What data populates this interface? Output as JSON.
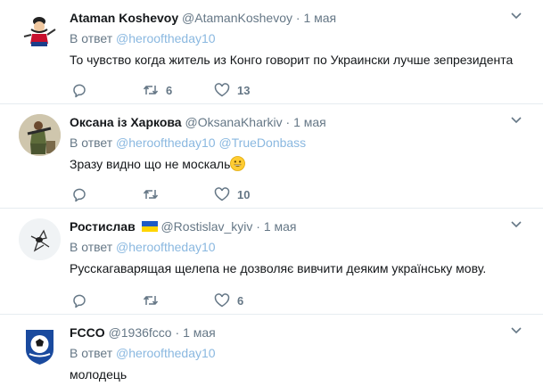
{
  "tweets": [
    {
      "name": "Ataman Koshevoy",
      "handle": "@AtamanKoshevoy",
      "separator": "·",
      "time": "1 мая",
      "reply_prefix": "В ответ",
      "reply_to": "@herooftheday10",
      "reply_to_2": "",
      "text": "То чувство когда житель из Конго говорит по Украински лучше зепрезидента",
      "retweets": "6",
      "likes": "13",
      "avatar_icon": "cossack-avatar"
    },
    {
      "name": "Оксана із Харкова",
      "handle": "@OksanaKharkiv",
      "separator": "·",
      "time": "1 мая",
      "reply_prefix": "В ответ",
      "reply_to": "@herooftheday10",
      "reply_to_2": "@TrueDonbass",
      "text": "Зразу видно що не москаль",
      "retweets": "",
      "likes": "10",
      "avatar_icon": "soldier-avatar"
    },
    {
      "name": "Ростислав",
      "handle": "@Rostislav_kyiv",
      "separator": "·",
      "time": "1 мая",
      "reply_prefix": "В ответ",
      "reply_to": "@herooftheday10",
      "reply_to_2": "",
      "text": "Русскагаварящая щелепа не дозволяє вивчити деяким українську мову.",
      "retweets": "",
      "likes": "6",
      "avatar_icon": "default-egg-avatar",
      "flag_icon": "ukraine-flag-icon"
    },
    {
      "name": "FCCO",
      "handle": "@1936fcco",
      "separator": "·",
      "time": "1 мая",
      "reply_prefix": "В ответ",
      "reply_to": "@herooftheday10",
      "reply_to_2": "",
      "text": "молодець",
      "avatar_icon": "football-club-logo"
    }
  ],
  "colors": {
    "muted": "#657786",
    "link": "#8ab8e0",
    "divider": "#e6ecf0",
    "flag_blue": "#1e5bc6",
    "flag_yellow": "#ffd500"
  }
}
